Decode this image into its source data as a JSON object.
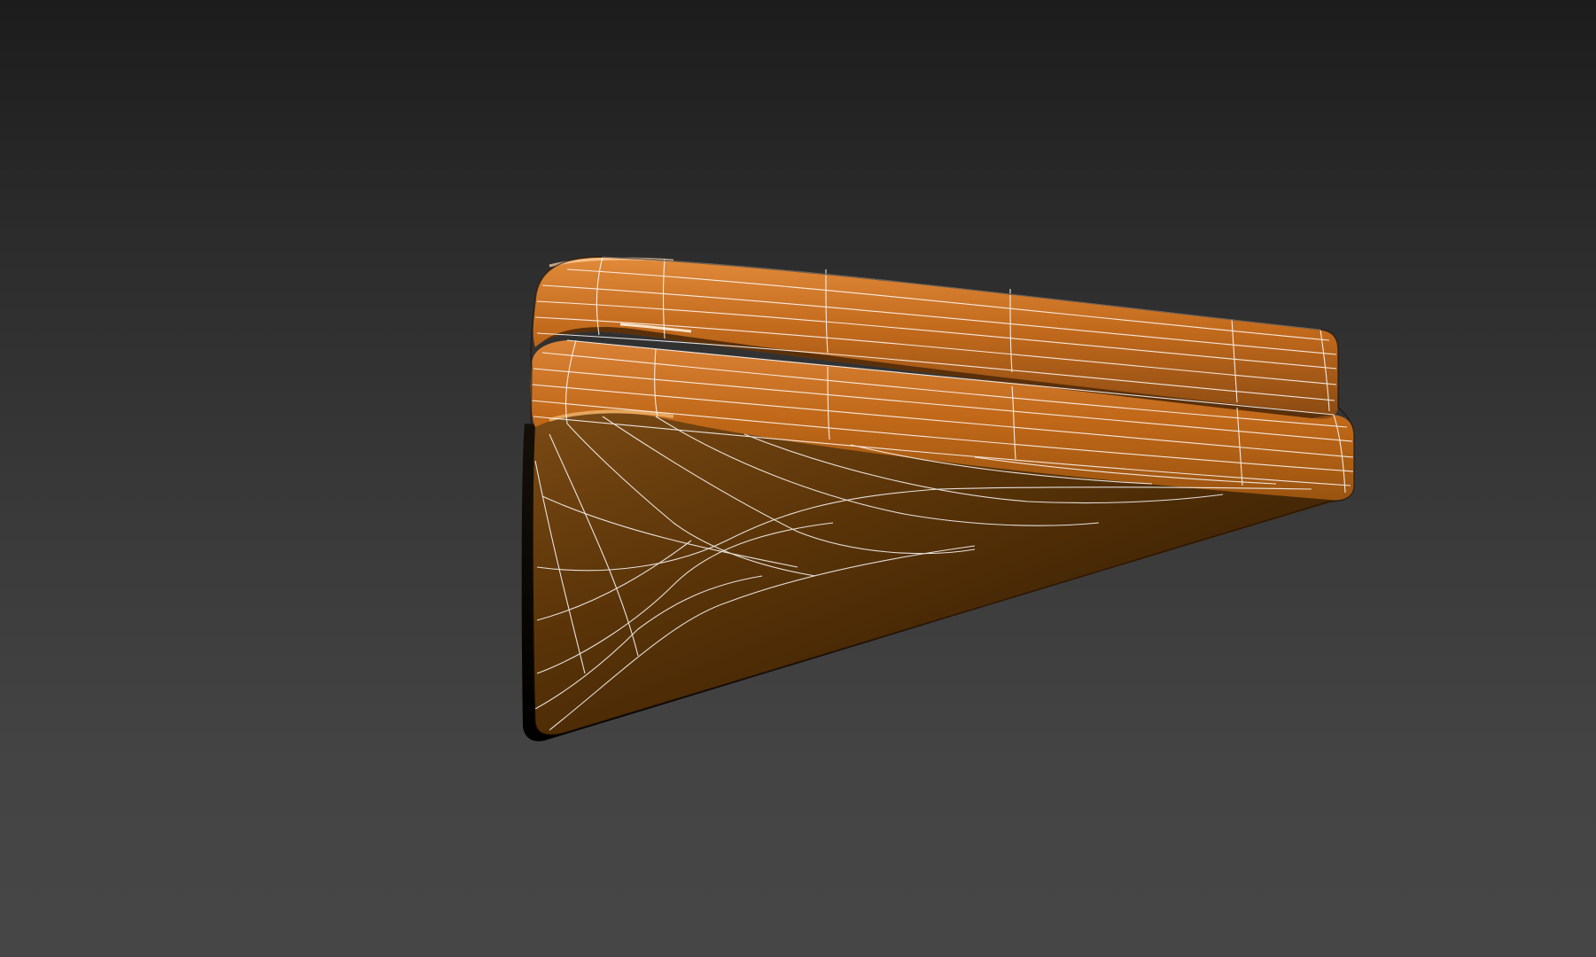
{
  "viewport": {
    "background_top": "#1c1c1c",
    "background_bottom": "#464646"
  },
  "model": {
    "object": "wedge-cushion-mesh",
    "material_color": "#c8701a",
    "material_dark": "#3a2006",
    "wireframe_color": "#ffffff"
  }
}
